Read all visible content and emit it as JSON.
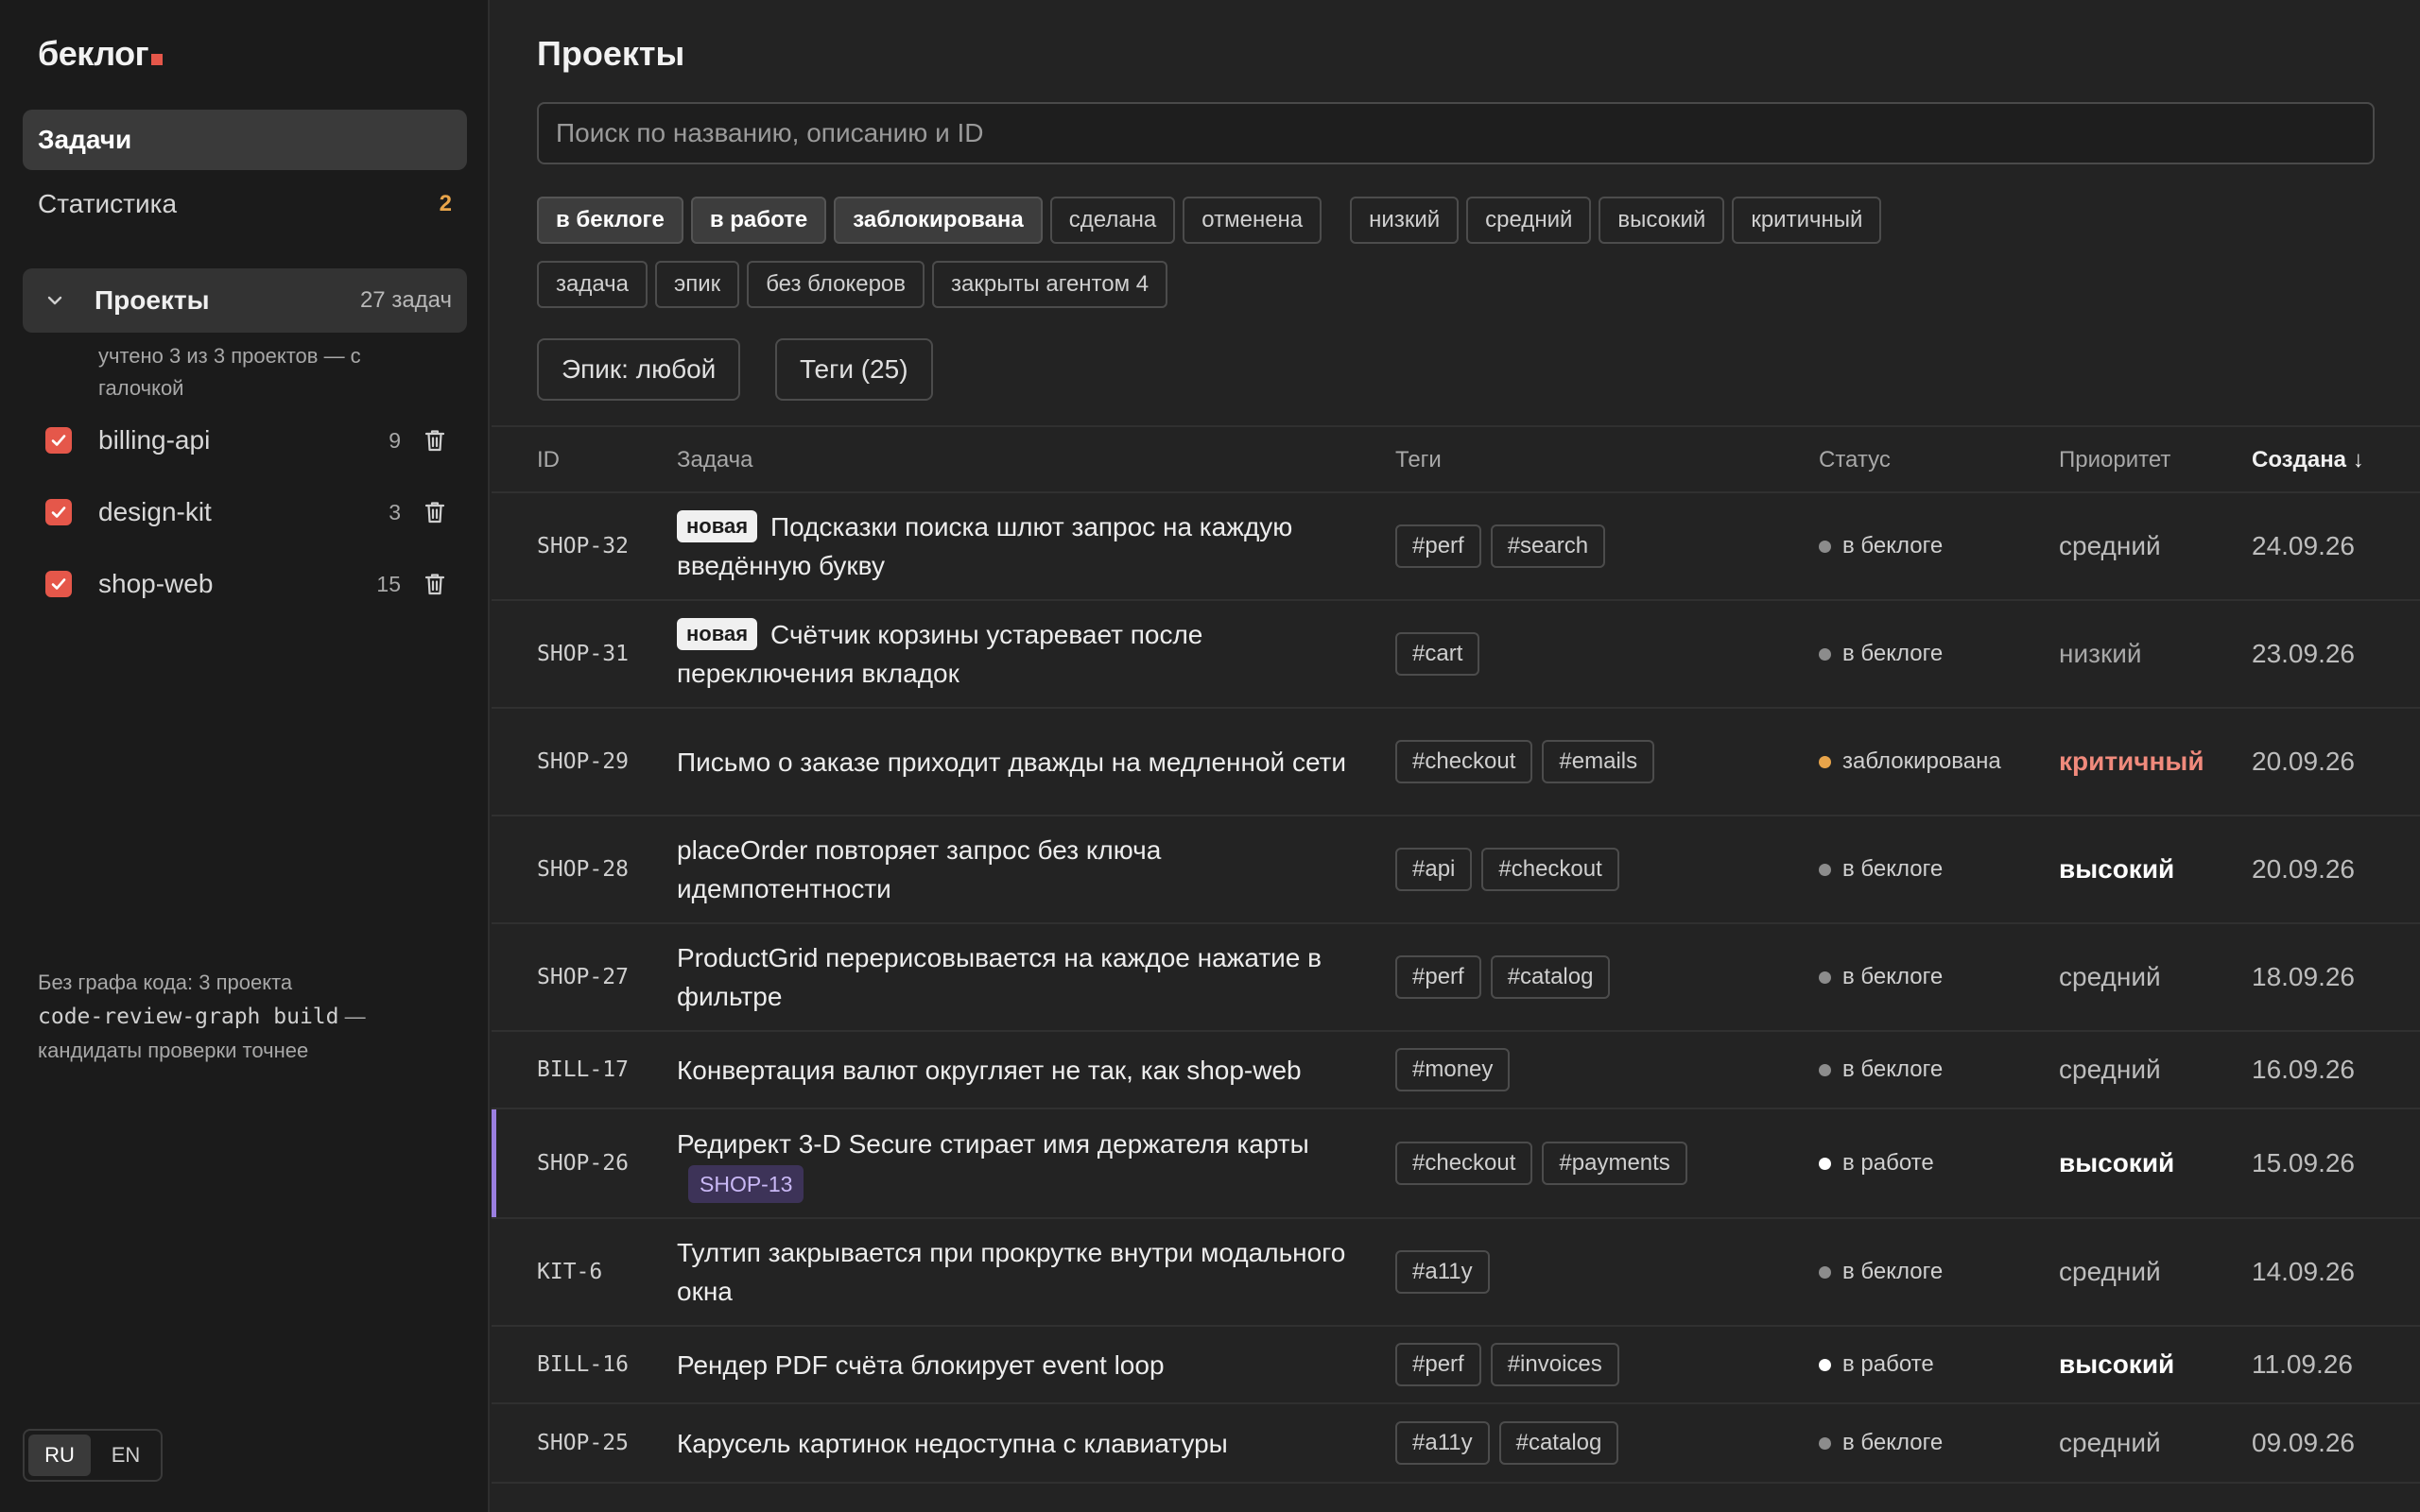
{
  "sidebar": {
    "logo": "беклог",
    "nav": [
      {
        "label": "Задачи",
        "count": ""
      },
      {
        "label": "Статистика",
        "count": "2"
      }
    ],
    "projects": {
      "title": "Проекты",
      "count": "27 задач",
      "note": "учтено 3 из 3 проектов — с галочкой",
      "items": [
        {
          "name": "billing-api",
          "count": "9"
        },
        {
          "name": "design-kit",
          "count": "3"
        },
        {
          "name": "shop-web",
          "count": "15"
        }
      ]
    },
    "graph_note": {
      "line1": "Без графа кода: 3 проекта",
      "command": "code-review-graph build",
      "line2": "—",
      "line3": "кандидаты проверки точнее"
    },
    "lang": [
      "RU",
      "EN"
    ]
  },
  "main": {
    "title": "Проекты",
    "search": {
      "placeholder": "Поиск по названию, описанию и ID",
      "value": ""
    },
    "status_chips": [
      "в беклоге",
      "в работе",
      "заблокирована",
      "сделана",
      "отменена"
    ],
    "priority_chips": [
      "низкий",
      "средний",
      "высокий",
      "критичный"
    ],
    "type_chips": [
      "задача",
      "эпик",
      "без блокеров",
      "закрыты агентом 4"
    ],
    "epic_filter": "Эпик: любой",
    "tags_filter": "Теги (25)",
    "columns": {
      "id": "ID",
      "task": "Задача",
      "tags": "Теги",
      "status": "Статус",
      "priority": "Приоритет",
      "created": "Создана ↓"
    },
    "new_badge": "новая",
    "rows": [
      {
        "id": "SHOP-32",
        "new": true,
        "title": "Подсказки поиска шлют запрос на каждую введённую букву",
        "parent": "",
        "tags": [
          "#perf",
          "#search"
        ],
        "status": "в беклоге",
        "priority": "средний",
        "date": "24.09.26"
      },
      {
        "id": "SHOP-31",
        "new": true,
        "title": "Счётчик корзины устаревает после переключения вкладок",
        "parent": "",
        "tags": [
          "#cart"
        ],
        "status": "в беклоге",
        "priority": "низкий",
        "date": "23.09.26"
      },
      {
        "id": "SHOP-29",
        "new": false,
        "title": "Письмо о заказе приходит дважды на медленной сети",
        "parent": "",
        "tags": [
          "#checkout",
          "#emails"
        ],
        "status": "заблокирована",
        "priority": "критичный",
        "date": "20.09.26"
      },
      {
        "id": "SHOP-28",
        "new": false,
        "title": "placeOrder повторяет запрос без ключа идемпотентности",
        "parent": "",
        "tags": [
          "#api",
          "#checkout"
        ],
        "status": "в беклоге",
        "priority": "высокий",
        "date": "20.09.26"
      },
      {
        "id": "SHOP-27",
        "new": false,
        "title": "ProductGrid перерисовывается на каждое нажатие в фильтре",
        "parent": "",
        "tags": [
          "#perf",
          "#catalog"
        ],
        "status": "в беклоге",
        "priority": "средний",
        "date": "18.09.26"
      },
      {
        "id": "BILL-17",
        "new": false,
        "title": "Конвертация валют округляет не так, как shop-web",
        "parent": "",
        "tags": [
          "#money"
        ],
        "status": "в беклоге",
        "priority": "средний",
        "date": "16.09.26"
      },
      {
        "id": "SHOP-26",
        "new": false,
        "title": "Редирект 3-D Secure стирает имя держателя карты",
        "parent": "SHOP-13",
        "tags": [
          "#checkout",
          "#payments"
        ],
        "status": "в работе",
        "priority": "высокий",
        "date": "15.09.26"
      },
      {
        "id": "KIT-6",
        "new": false,
        "title": "Тултип закрывается при прокрутке внутри модального окна",
        "parent": "",
        "tags": [
          "#a11y"
        ],
        "status": "в беклоге",
        "priority": "средний",
        "date": "14.09.26"
      },
      {
        "id": "BILL-16",
        "new": false,
        "title": "Рендер PDF счёта блокирует event loop",
        "parent": "",
        "tags": [
          "#perf",
          "#invoices"
        ],
        "status": "в работе",
        "priority": "высокий",
        "date": "11.09.26"
      },
      {
        "id": "SHOP-25",
        "new": false,
        "title": "Карусель картинок недоступна с клавиатуры",
        "parent": "",
        "tags": [
          "#a11y",
          "#catalog"
        ],
        "status": "в беклоге",
        "priority": "средний",
        "date": "09.09.26"
      }
    ]
  },
  "colors": {
    "accent": "#e5574a",
    "status_backlog": "#8c8c8c",
    "status_blocked": "#e8a44a",
    "status_in_progress": "#ffffff",
    "priority_critical": "#f08a7c",
    "marked_row": "#9b7fe0"
  }
}
